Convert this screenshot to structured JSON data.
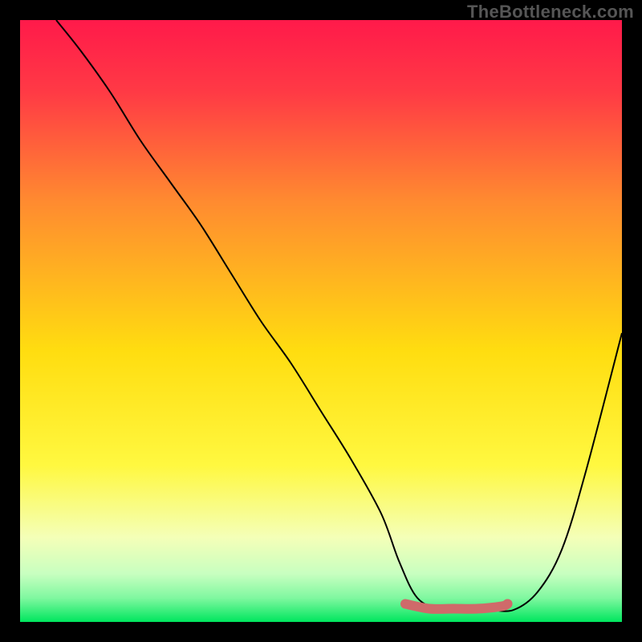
{
  "watermark": "TheBottleneck.com",
  "chart_data": {
    "type": "line",
    "title": "",
    "xlabel": "",
    "ylabel": "",
    "xlim": [
      0,
      100
    ],
    "ylim": [
      0,
      100
    ],
    "background_gradient": {
      "top": "#ff1a4a",
      "mid": "#ffe600",
      "bottom": "#00e65e"
    },
    "series": [
      {
        "name": "bottleneck-curve",
        "x": [
          6,
          10,
          15,
          20,
          25,
          30,
          35,
          40,
          45,
          50,
          55,
          60,
          63,
          66,
          70,
          74,
          78,
          82,
          86,
          90,
          94,
          100
        ],
        "y": [
          100,
          95,
          88,
          80,
          73,
          66,
          58,
          50,
          43,
          35,
          27,
          18,
          10,
          4,
          2,
          2,
          2,
          2,
          5,
          12,
          25,
          48
        ],
        "stroke": "#000000",
        "stroke_width": 2
      },
      {
        "name": "marker-band",
        "x": [
          64,
          68,
          72,
          76,
          80,
          81
        ],
        "y": [
          3.0,
          2.2,
          2.2,
          2.2,
          2.6,
          3.0
        ],
        "stroke": "#cf6a6a",
        "stroke_width": 12
      }
    ],
    "markers": [
      {
        "name": "end-dot",
        "x": 81,
        "y": 3.0,
        "r": 6,
        "fill": "#cf6a6a"
      }
    ]
  }
}
